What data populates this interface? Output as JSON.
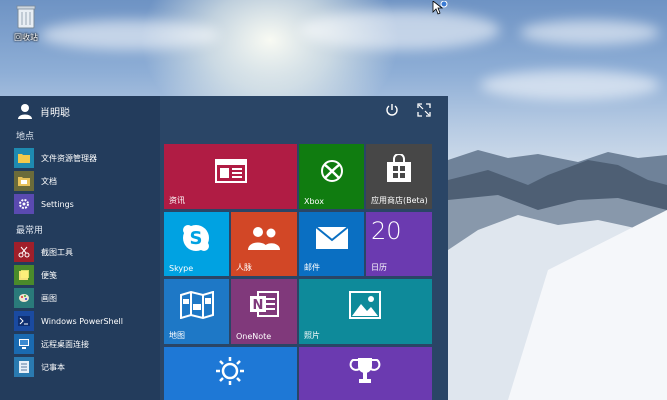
{
  "desktop": {
    "recycle_bin_label": "回收站"
  },
  "start_menu": {
    "user_name": "肖明聪",
    "sections": {
      "places": "地点",
      "most_used": "最常用"
    },
    "places": [
      {
        "label": "文件资源管理器",
        "icon": "folder-icon",
        "color": "#1e8ab0"
      },
      {
        "label": "文档",
        "icon": "documents-icon",
        "color": "#6b6b3a"
      },
      {
        "label": "Settings",
        "icon": "gear-icon",
        "color": "#5a4ab0"
      }
    ],
    "most_used": [
      {
        "label": "截图工具",
        "icon": "scissors-icon",
        "color": "#a01f2a"
      },
      {
        "label": "便笺",
        "icon": "sticky-notes-icon",
        "color": "#4a8a2a"
      },
      {
        "label": "画图",
        "icon": "paint-icon",
        "color": "#2a7a7a"
      },
      {
        "label": "Windows PowerShell",
        "icon": "powershell-icon",
        "color": "#1a4aa0"
      },
      {
        "label": "远程桌面连接",
        "icon": "remote-desktop-icon",
        "color": "#1a6ab0"
      },
      {
        "label": "记事本",
        "icon": "notepad-icon",
        "color": "#2a7ab0"
      }
    ],
    "tiles": [
      {
        "key": "news",
        "label": "资讯",
        "icon": "news-icon",
        "color": "#b01c44"
      },
      {
        "key": "xbox",
        "label": "Xbox",
        "icon": "xbox-icon",
        "color": "#107c10"
      },
      {
        "key": "store",
        "label": "应用商店(Beta)",
        "icon": "store-icon",
        "color": "#474747"
      },
      {
        "key": "skype",
        "label": "Skype",
        "icon": "skype-icon",
        "color": "#00a2e2"
      },
      {
        "key": "people",
        "label": "人脉",
        "icon": "people-icon",
        "color": "#d24726"
      },
      {
        "key": "mail",
        "label": "邮件",
        "icon": "mail-icon",
        "color": "#0a6fc2"
      },
      {
        "key": "calendar",
        "label": "日历",
        "icon": "calendar-icon",
        "color": "#6b3ab0",
        "number": "20"
      },
      {
        "key": "maps",
        "label": "地图",
        "icon": "map-icon",
        "color": "#1e78c6"
      },
      {
        "key": "onenote",
        "label": "OneNote",
        "icon": "onenote-icon",
        "color": "#80397b"
      },
      {
        "key": "photos",
        "label": "照片",
        "icon": "photos-icon",
        "color": "#0e8a9a"
      },
      {
        "key": "weather",
        "label": "",
        "icon": "weather-sun-icon",
        "color": "#1e78d6"
      },
      {
        "key": "achievements",
        "label": "",
        "icon": "trophy-icon",
        "color": "#6b3ab0"
      }
    ]
  }
}
